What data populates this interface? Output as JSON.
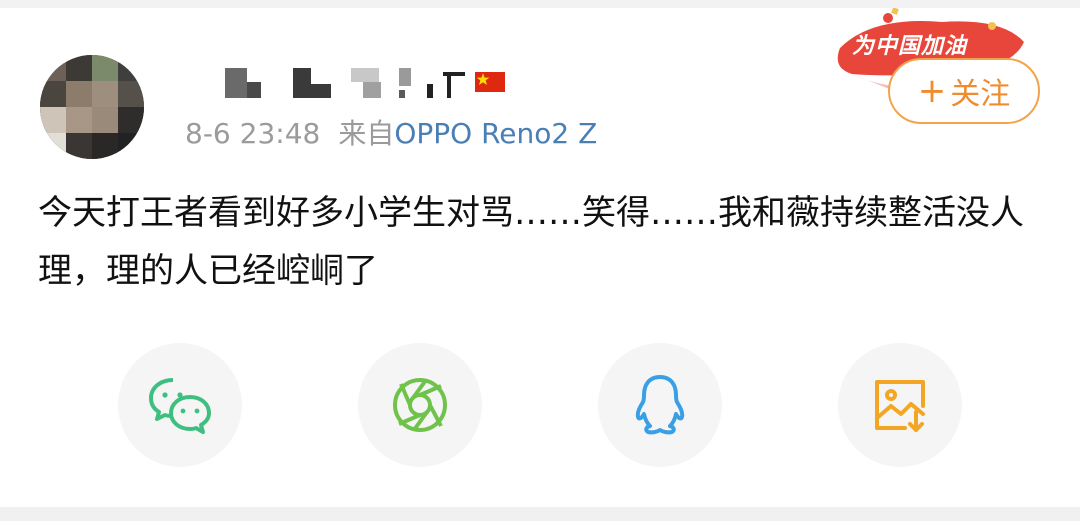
{
  "post": {
    "author_name": "",
    "time": "8-6 23:48",
    "source_prefix": "来自",
    "source_device": "OPPO Reno2 Z",
    "text": "今天打王者看到好多小学生对骂……笑得……我和薇持续整活没人理，理的人已经崆峒了"
  },
  "badge": {
    "text": "为中国加油"
  },
  "follow_button": {
    "plus": "+",
    "label": "关注"
  },
  "share": [
    {
      "name": "wechat",
      "icon": "wechat-icon",
      "color": "#3fbf7f"
    },
    {
      "name": "moments",
      "icon": "moments-icon",
      "color": "#6fc24a"
    },
    {
      "name": "qq",
      "icon": "qq-icon",
      "color": "#3aa0e6"
    },
    {
      "name": "save-image",
      "icon": "save-image-icon",
      "color": "#f3a623"
    }
  ],
  "colors": {
    "accent": "#f08c30",
    "link": "#4a7fb5",
    "meta": "#9b9b9b",
    "text": "#111111"
  }
}
